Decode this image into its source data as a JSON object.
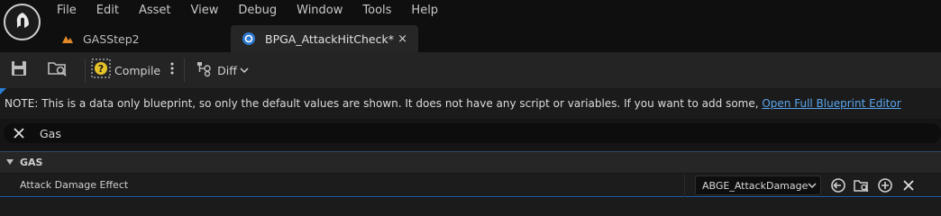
{
  "menu": {
    "items": [
      "File",
      "Edit",
      "Asset",
      "View",
      "Debug",
      "Window",
      "Tools",
      "Help"
    ]
  },
  "tabs": [
    {
      "label": "GASStep2",
      "icon": "level-icon"
    },
    {
      "label": "BPGA_AttackHitCheck*",
      "icon": "blueprint-icon",
      "close": "×"
    }
  ],
  "toolbar": {
    "compile_label": "Compile",
    "diff_label": "Diff"
  },
  "notice": {
    "text": "NOTE: This is a data only blueprint, so only the default values are shown.  It does not have any script or variables.  If you want to add some, ",
    "link": "Open Full Blueprint Editor"
  },
  "search": {
    "value": "Gas"
  },
  "details": {
    "category": "GAS",
    "property": {
      "name": "Attack Damage Effect",
      "value": "ABGE_AttackDamage"
    }
  },
  "colors": {
    "accent": "#2a7fd6",
    "link": "#5aa6ef",
    "compile_warning": "#e6c229"
  }
}
